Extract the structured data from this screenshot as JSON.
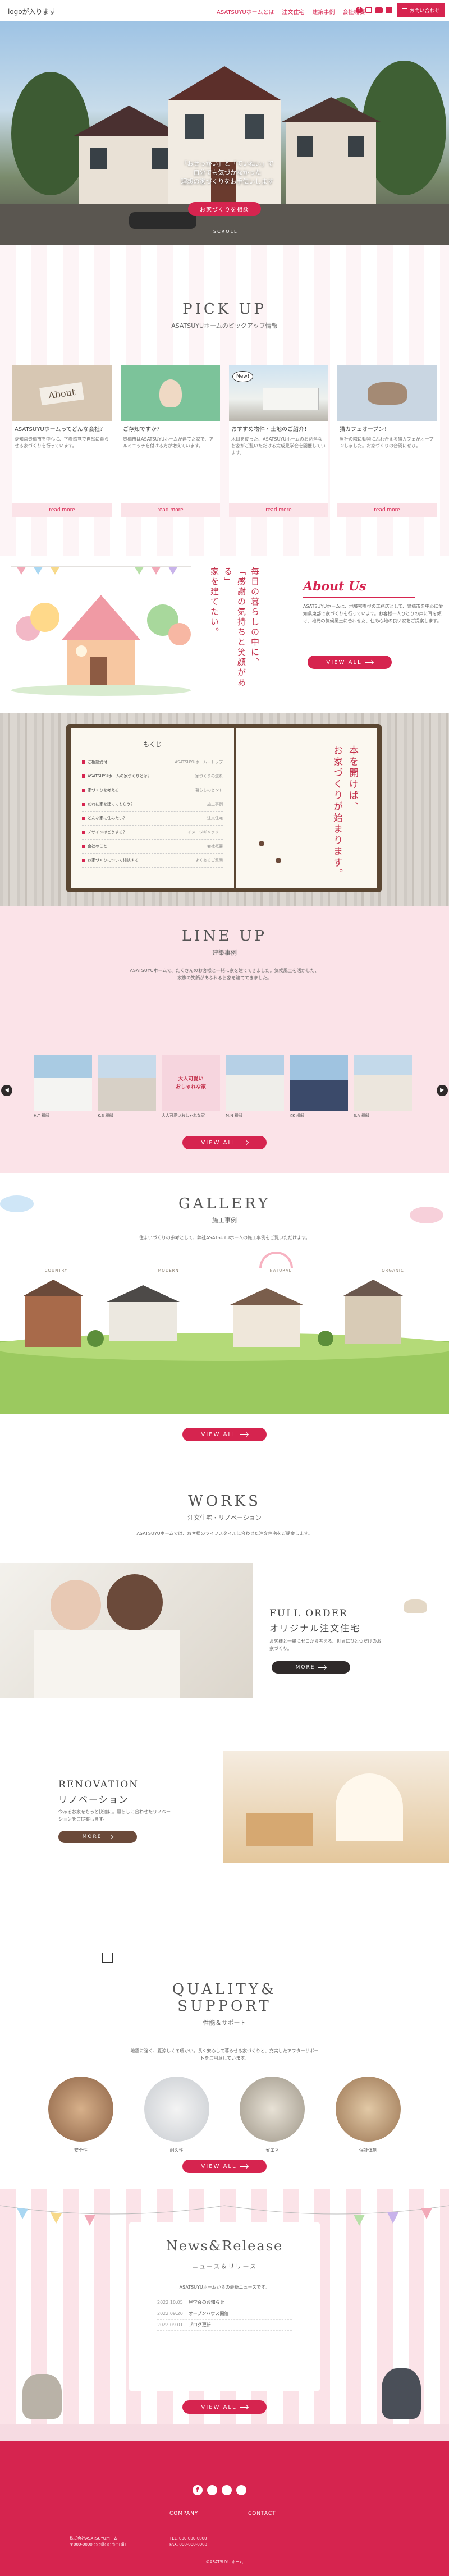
{
  "header": {
    "logo": "logoが入ります",
    "nav": [
      "ASATSUYUホームとは",
      "注文住宅",
      "建築事例",
      "会社概要"
    ],
    "contact": "お問い合わせ"
  },
  "hero": {
    "lines": [
      "「おせっかい」と「ていねい」で",
      "自分でも気づかなかった",
      "理想の家づくりをお手伝いします"
    ],
    "button": "お家づくりを相談",
    "scroll": "SCROLL"
  },
  "pickup": {
    "en": "PICK UP",
    "ja": "ASATSUYUホームのピックアップ情報",
    "cards": [
      {
        "image": "About",
        "title": "ASATSUYUホームってどんな会社？",
        "text": "愛知県豊橋市を中心に、下着感覚で自然に暮らせる家づくりを行っています。",
        "more": "read more"
      },
      {
        "image": "",
        "title": "ご存知ですか？",
        "text": "豊橋市はASATSUYUホームが建てた家で、アルミニッチを付ける方が増えています。",
        "more": "read more"
      },
      {
        "image": "New!",
        "title": "おすすめ物件・土地のご紹介！",
        "text": "木目を使った、ASATSUYUホームのお洒落なお家がご覧いただける完成見学会を開催しています。",
        "more": "read more"
      },
      {
        "image": "",
        "title": "猫カフェオープン！",
        "text": "当社の隣に動物にふれ合える猫カフェがオープンしました。お家づくりの合間にぜひ。",
        "more": "read more"
      }
    ]
  },
  "about": {
    "vertical": [
      "毎日の暮らしの中に、",
      "「感謝の気持ちと笑顔がある」",
      "家を建てたい。"
    ],
    "title": "About Us",
    "text": "ASATSUYUホームは、地域密着型の工務店として、豊橋市を中心に愛知県東部で家づくりを行っています。お客様一人ひとりの声に耳を傾け、地元の気候風土に合わせた、住み心地の良い家をご提案します。",
    "button": "VIEW ALL"
  },
  "book": {
    "title": "もくじ",
    "items": [
      {
        "label": "ご相談受付",
        "page": "ASATSUYUホーム・トップ"
      },
      {
        "label": "ASATSUYUホームの家づくりとは？",
        "page": "家づくりの流れ"
      },
      {
        "label": "家づくりを考える",
        "page": "暮らしのヒント"
      },
      {
        "label": "だれに家を建ててもらう？",
        "page": "施工事例"
      },
      {
        "label": "どんな家に住みたい？",
        "page": "注文住宅"
      },
      {
        "label": "デザインはどうする？",
        "page": "イメージギャラリー"
      },
      {
        "label": "会社のこと",
        "page": "会社概要"
      },
      {
        "label": "お家づくりについて相談する",
        "page": "よくあるご質問"
      }
    ],
    "vertical": [
      "本を開けば、",
      "お家づくりが始まります。"
    ]
  },
  "lineup": {
    "en": "LINE UP",
    "ja": "建築事例",
    "text": "ASATSUYUホームで、たくさんのお客様と一緒に家を建ててきました。気候風土を活かした、家族の笑顔があふれるお家を建ててきました。",
    "houses": [
      "H.T 様邸",
      "K.S 様邸",
      "大人可愛いおしゃれな家",
      "M.N 様邸",
      "Y.K 様邸",
      "S.A 様邸"
    ],
    "banner_lines": [
      "大人可愛い",
      "おしゃれな家"
    ],
    "button": "VIEW ALL"
  },
  "gallery": {
    "en": "GALLERY",
    "ja": "施工事例",
    "text": "住まいづくりの参考として、弊社ASATSUYUホームの施工事例をご覧いただけます。",
    "cats": [
      "COUNTRY",
      "MODERN",
      "NATURAL",
      "ORGANIC"
    ],
    "button": "VIEW ALL"
  },
  "works": {
    "en": "WORKS",
    "ja": "注文住宅・リノベーション",
    "text": "ASATSUYUホームでは、お客様のライフスタイルに合わせた注文住宅をご提案します。",
    "fullorder_en": "FULL ORDER",
    "fullorder_ja": "オリジナル注文住宅",
    "fullorder_text": "お客様と一緒にゼロから考える、世界にひとつだけのお家づくり。",
    "fullorder_button": "MORE",
    "renovation_en": "RENOVATION",
    "renovation_ja": "リノベーション",
    "renovation_text": "今あるお家をもっと快適に。暮らしに合わせたリノベーションをご提案します。",
    "renovation_button": "MORE"
  },
  "quality": {
    "en1": "QUALITY&",
    "en2": "SUPPORT",
    "ja": "性能＆サポート",
    "text": "地震に強く、夏涼しく冬暖かい。長く安心して暮らせる家づくりと、充実したアフターサポートをご用意しています。",
    "items": [
      "安全性",
      "耐久性",
      "省エネ",
      "保証体制"
    ],
    "button": "VIEW ALL"
  },
  "news": {
    "title": "News&Release",
    "ja": "ニュース＆リリース",
    "text": "ASATSUYUホームからの最新ニュースです。",
    "items": [
      {
        "date": "2022.10.05",
        "title": "見学会のお知らせ"
      },
      {
        "date": "2022.09.20",
        "title": "オープンハウス開催"
      },
      {
        "date": "2022.09.01",
        "title": "ブログ更新"
      }
    ],
    "button": "VIEW ALL"
  },
  "footer": {
    "company_label": "COMPANY",
    "contact_label": "CONTACT",
    "company_lines": [
      "株式会社ASATSUYUホーム",
      "〒000-0000 ○○県○○市○○町"
    ],
    "contact_lines": [
      "TEL. 000-000-0000",
      "FAX. 000-000-0000"
    ],
    "copyright": "©ASATSUYU ホーム"
  },
  "colors": {
    "accent": "#d6244f",
    "pink_bg": "#fbe3e8",
    "dark_btn": "#2f2a2a",
    "brown_btn": "#6b4a3a"
  }
}
